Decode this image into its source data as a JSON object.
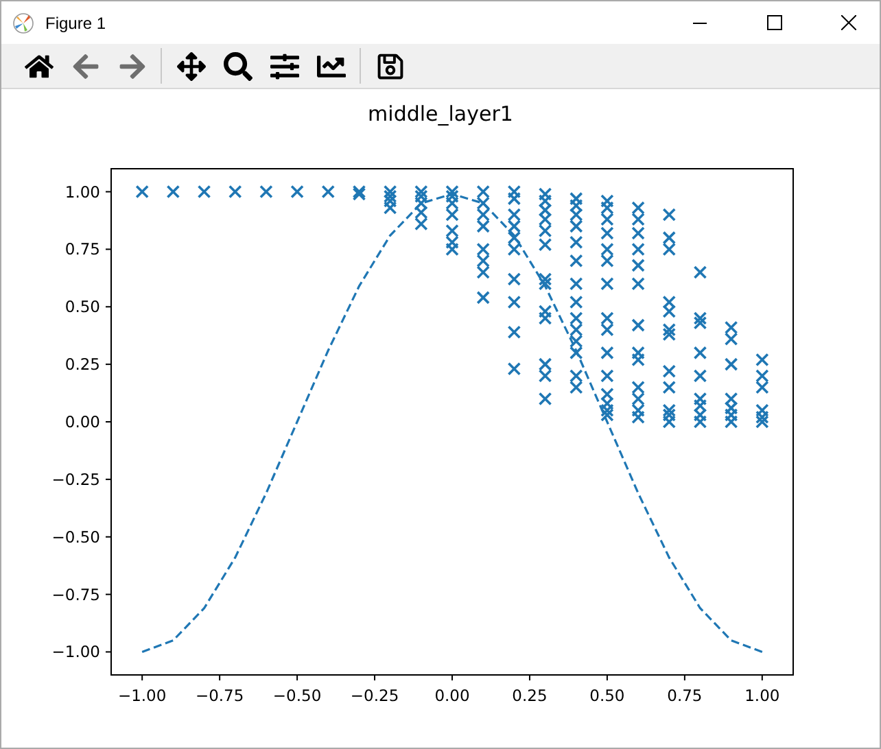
{
  "window": {
    "title": "Figure 1"
  },
  "toolbar": [
    {
      "kind": "home",
      "disabled": false
    },
    {
      "kind": "back",
      "disabled": true
    },
    {
      "kind": "forward",
      "disabled": true
    },
    {
      "kind": "separator"
    },
    {
      "kind": "pan",
      "disabled": false
    },
    {
      "kind": "zoom",
      "disabled": false
    },
    {
      "kind": "configure",
      "disabled": false
    },
    {
      "kind": "axes",
      "disabled": false
    },
    {
      "kind": "separator"
    },
    {
      "kind": "save",
      "disabled": false
    }
  ],
  "figure": {
    "chart_data": {
      "type": "scatter",
      "title": "middle_layer1",
      "xlim": [
        -1.1,
        1.1
      ],
      "ylim": [
        -1.1,
        1.1
      ],
      "xticks": [
        {
          "value": -1,
          "label": "−1.00"
        },
        {
          "value": -0.75,
          "label": "−0.75"
        },
        {
          "value": -0.5,
          "label": "−0.50"
        },
        {
          "value": -0.25,
          "label": "−0.25"
        },
        {
          "value": 0,
          "label": "0.00"
        },
        {
          "value": 0.25,
          "label": "0.25"
        },
        {
          "value": 0.5,
          "label": "0.50"
        },
        {
          "value": 0.75,
          "label": "0.75"
        },
        {
          "value": 1,
          "label": "1.00"
        }
      ],
      "yticks": [
        {
          "value": -1,
          "label": "−1.00"
        },
        {
          "value": -0.75,
          "label": "−0.75"
        },
        {
          "value": -0.5,
          "label": "−0.50"
        },
        {
          "value": -0.25,
          "label": "−0.25"
        },
        {
          "value": 0,
          "label": "0.00"
        },
        {
          "value": 0.25,
          "label": "0.25"
        },
        {
          "value": 0.5,
          "label": "0.50"
        },
        {
          "value": 0.75,
          "label": "0.75"
        },
        {
          "value": 1,
          "label": "1.00"
        }
      ],
      "series": [
        {
          "type": "scatter",
          "color": "#1f77b4",
          "x": [
            -1,
            -0.9,
            -0.8,
            -0.7,
            -0.6,
            -0.5,
            -0.4,
            -0.3,
            -0.3,
            -0.2,
            -0.2,
            -0.2,
            -0.2,
            -0.1,
            -0.1,
            -0.1,
            -0.1,
            -0.1,
            0,
            0,
            0,
            0,
            0,
            0,
            0,
            0.1,
            0.1,
            0.1,
            0.1,
            0.1,
            0.1,
            0.1,
            0.1,
            0.2,
            0.2,
            0.2,
            0.2,
            0.2,
            0.2,
            0.2,
            0.2,
            0.2,
            0.2,
            0.3,
            0.3,
            0.3,
            0.3,
            0.3,
            0.3,
            0.3,
            0.3,
            0.3,
            0.3,
            0.3,
            0.3,
            0.3,
            0.4,
            0.4,
            0.4,
            0.4,
            0.4,
            0.4,
            0.4,
            0.4,
            0.4,
            0.4,
            0.4,
            0.4,
            0.4,
            0.4,
            0.5,
            0.5,
            0.5,
            0.5,
            0.5,
            0.5,
            0.5,
            0.5,
            0.5,
            0.5,
            0.5,
            0.5,
            0.5,
            0.5,
            0.5,
            0.6,
            0.6,
            0.6,
            0.6,
            0.6,
            0.6,
            0.6,
            0.6,
            0.6,
            0.6,
            0.6,
            0.6,
            0.6,
            0.7,
            0.7,
            0.7,
            0.7,
            0.7,
            0.7,
            0.7,
            0.7,
            0.7,
            0.7,
            0.7,
            0.7,
            0.8,
            0.8,
            0.8,
            0.8,
            0.8,
            0.8,
            0.8,
            0.8,
            0.8,
            0.9,
            0.9,
            0.9,
            0.9,
            0.9,
            0.9,
            0.9,
            1,
            1,
            1,
            1,
            1,
            1
          ],
          "values": [
            1,
            1,
            1,
            1,
            1,
            1,
            1,
            1,
            0.99,
            1,
            0.98,
            0.96,
            0.93,
            1,
            0.98,
            0.95,
            0.91,
            0.86,
            1,
            0.98,
            0.95,
            0.9,
            0.83,
            0.78,
            0.75,
            1,
            0.95,
            0.9,
            0.85,
            0.75,
            0.7,
            0.65,
            0.54,
            1,
            0.97,
            0.9,
            0.85,
            0.8,
            0.75,
            0.62,
            0.52,
            0.39,
            0.23,
            0.99,
            0.96,
            0.92,
            0.88,
            0.83,
            0.77,
            0.62,
            0.6,
            0.48,
            0.45,
            0.25,
            0.2,
            0.1,
            0.97,
            0.94,
            0.9,
            0.85,
            0.78,
            0.7,
            0.6,
            0.52,
            0.45,
            0.4,
            0.35,
            0.3,
            0.2,
            0.15,
            0.96,
            0.93,
            0.88,
            0.82,
            0.75,
            0.7,
            0.6,
            0.45,
            0.4,
            0.3,
            0.2,
            0.12,
            0.08,
            0.05,
            0.03,
            0.93,
            0.88,
            0.82,
            0.75,
            0.68,
            0.6,
            0.42,
            0.3,
            0.27,
            0.15,
            0.1,
            0.05,
            0.02,
            0.9,
            0.8,
            0.75,
            0.52,
            0.48,
            0.4,
            0.38,
            0.22,
            0.15,
            0.05,
            0.03,
            0,
            0.65,
            0.45,
            0.43,
            0.3,
            0.2,
            0.1,
            0.07,
            0.03,
            0,
            0.41,
            0.36,
            0.25,
            0.1,
            0.06,
            0.03,
            0,
            0.27,
            0.2,
            0.15,
            0.05,
            0.02,
            0
          ]
        },
        {
          "type": "line",
          "line_style": "dashed",
          "color": "#1f77b4",
          "x": [
            -1,
            -0.9,
            -0.8,
            -0.7,
            -0.6,
            -0.5,
            -0.4,
            -0.3,
            -0.2,
            -0.1,
            0,
            0.1,
            0.2,
            0.3,
            0.4,
            0.5,
            0.6,
            0.7,
            0.8,
            0.9,
            1
          ],
          "values": [
            -1,
            -0.95,
            -0.81,
            -0.59,
            -0.31,
            0,
            0.31,
            0.59,
            0.81,
            0.95,
            0.99,
            0.95,
            0.81,
            0.59,
            0.31,
            0,
            -0.31,
            -0.59,
            -0.81,
            -0.95,
            -1
          ]
        }
      ]
    }
  }
}
